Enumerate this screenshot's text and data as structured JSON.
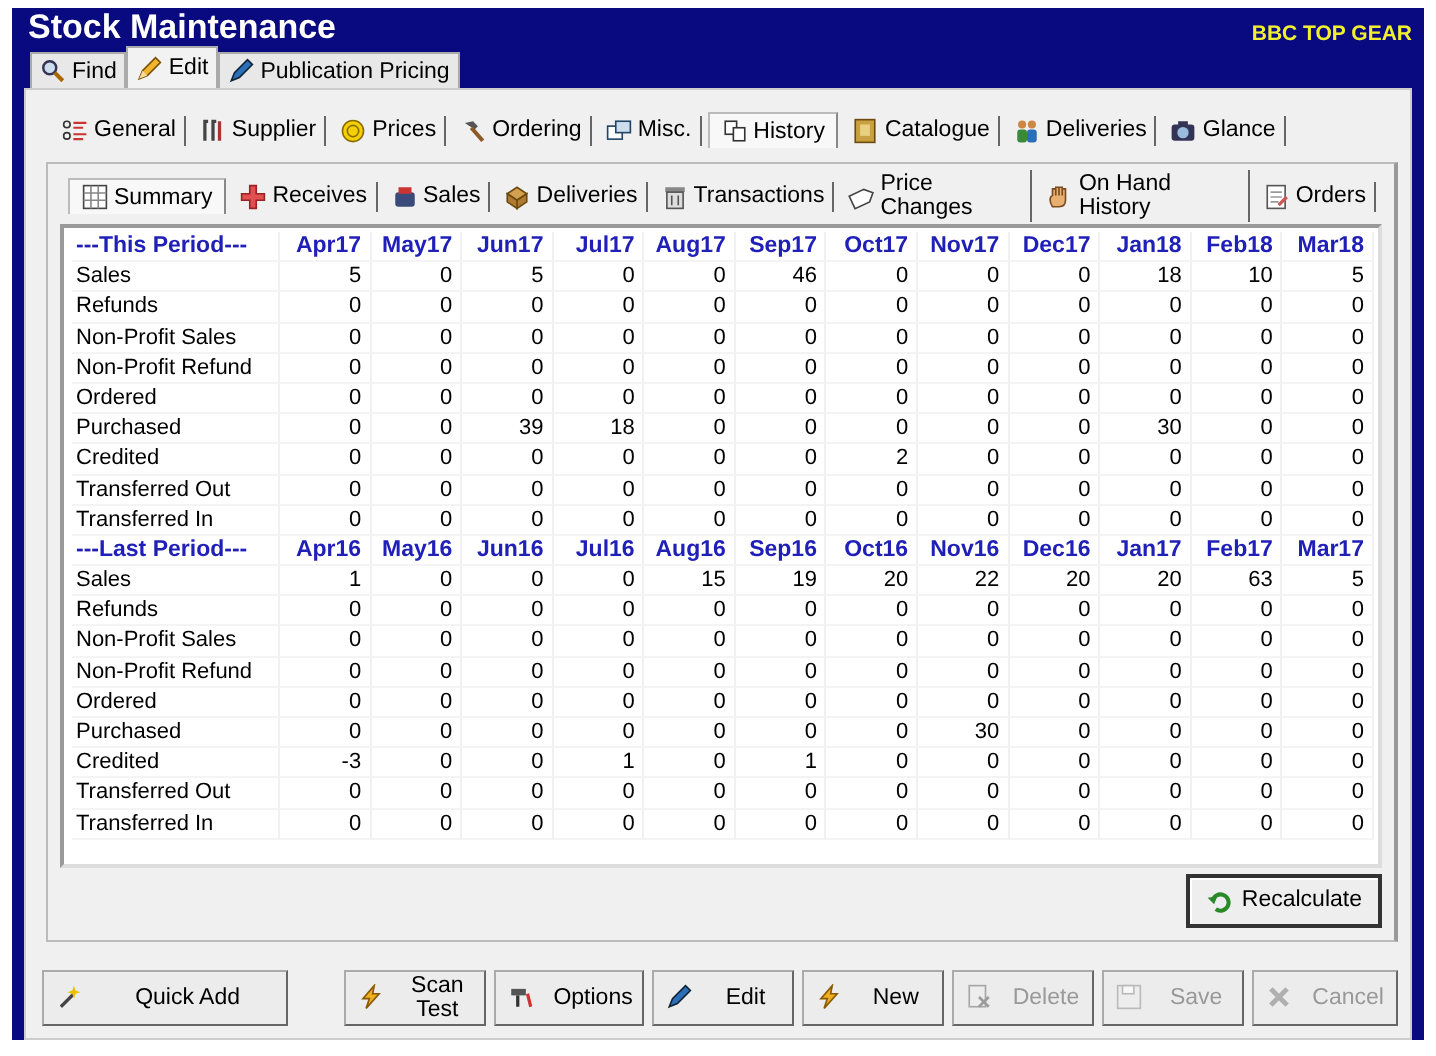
{
  "window": {
    "title": "Stock Maintenance",
    "store": "BBC TOP GEAR"
  },
  "tabs": [
    {
      "label": "Find",
      "selected": false
    },
    {
      "label": "Edit",
      "selected": true
    },
    {
      "label": "Publication Pricing",
      "selected": false
    }
  ],
  "section_tabs": [
    {
      "label": "General",
      "selected": false
    },
    {
      "label": "Supplier",
      "selected": false
    },
    {
      "label": "Prices",
      "selected": false
    },
    {
      "label": "Ordering",
      "selected": false
    },
    {
      "label": "Misc.",
      "selected": false
    },
    {
      "label": "History",
      "selected": true
    },
    {
      "label": "Catalogue",
      "selected": false
    },
    {
      "label": "Deliveries",
      "selected": false
    },
    {
      "label": "Glance",
      "selected": false
    }
  ],
  "history_tabs": [
    {
      "label": "Summary",
      "selected": true
    },
    {
      "label": "Receives",
      "selected": false
    },
    {
      "label": "Sales",
      "selected": false
    },
    {
      "label": "Deliveries",
      "selected": false
    },
    {
      "label": "Transactions",
      "selected": false
    },
    {
      "label": "Price Changes",
      "selected": false
    },
    {
      "label": "On Hand History",
      "selected": false
    },
    {
      "label": "Orders",
      "selected": false
    }
  ],
  "periods": [
    {
      "title": "---This Period---",
      "months": [
        "Apr17",
        "May17",
        "Jun17",
        "Jul17",
        "Aug17",
        "Sep17",
        "Oct17",
        "Nov17",
        "Dec17",
        "Jan18",
        "Feb18",
        "Mar18"
      ],
      "rows": [
        {
          "label": "Sales",
          "values": [
            "5",
            "0",
            "5",
            "0",
            "0",
            "46",
            "0",
            "0",
            "0",
            "18",
            "10",
            "5"
          ]
        },
        {
          "label": "Refunds",
          "values": [
            "0",
            "0",
            "0",
            "0",
            "0",
            "0",
            "0",
            "0",
            "0",
            "0",
            "0",
            "0"
          ]
        },
        {
          "label": "Non-Profit Sales",
          "values": [
            "0",
            "0",
            "0",
            "0",
            "0",
            "0",
            "0",
            "0",
            "0",
            "0",
            "0",
            "0"
          ]
        },
        {
          "label": "Non-Profit Refund",
          "values": [
            "0",
            "0",
            "0",
            "0",
            "0",
            "0",
            "0",
            "0",
            "0",
            "0",
            "0",
            "0"
          ]
        },
        {
          "label": "Ordered",
          "values": [
            "0",
            "0",
            "0",
            "0",
            "0",
            "0",
            "0",
            "0",
            "0",
            "0",
            "0",
            "0"
          ]
        },
        {
          "label": "Purchased",
          "values": [
            "0",
            "0",
            "39",
            "18",
            "0",
            "0",
            "0",
            "0",
            "0",
            "30",
            "0",
            "0"
          ]
        },
        {
          "label": "Credited",
          "values": [
            "0",
            "0",
            "0",
            "0",
            "0",
            "0",
            "2",
            "0",
            "0",
            "0",
            "0",
            "0"
          ]
        },
        {
          "label": "Transferred Out",
          "values": [
            "0",
            "0",
            "0",
            "0",
            "0",
            "0",
            "0",
            "0",
            "0",
            "0",
            "0",
            "0"
          ]
        },
        {
          "label": "Transferred In",
          "values": [
            "0",
            "0",
            "0",
            "0",
            "0",
            "0",
            "0",
            "0",
            "0",
            "0",
            "0",
            "0"
          ]
        }
      ]
    },
    {
      "title": "---Last Period---",
      "months": [
        "Apr16",
        "May16",
        "Jun16",
        "Jul16",
        "Aug16",
        "Sep16",
        "Oct16",
        "Nov16",
        "Dec16",
        "Jan17",
        "Feb17",
        "Mar17"
      ],
      "rows": [
        {
          "label": "Sales",
          "values": [
            "1",
            "0",
            "0",
            "0",
            "15",
            "19",
            "20",
            "22",
            "20",
            "20",
            "63",
            "5"
          ]
        },
        {
          "label": "Refunds",
          "values": [
            "0",
            "0",
            "0",
            "0",
            "0",
            "0",
            "0",
            "0",
            "0",
            "0",
            "0",
            "0"
          ]
        },
        {
          "label": "Non-Profit Sales",
          "values": [
            "0",
            "0",
            "0",
            "0",
            "0",
            "0",
            "0",
            "0",
            "0",
            "0",
            "0",
            "0"
          ]
        },
        {
          "label": "Non-Profit Refund",
          "values": [
            "0",
            "0",
            "0",
            "0",
            "0",
            "0",
            "0",
            "0",
            "0",
            "0",
            "0",
            "0"
          ]
        },
        {
          "label": "Ordered",
          "values": [
            "0",
            "0",
            "0",
            "0",
            "0",
            "0",
            "0",
            "0",
            "0",
            "0",
            "0",
            "0"
          ]
        },
        {
          "label": "Purchased",
          "values": [
            "0",
            "0",
            "0",
            "0",
            "0",
            "0",
            "0",
            "30",
            "0",
            "0",
            "0",
            "0"
          ]
        },
        {
          "label": "Credited",
          "values": [
            "-3",
            "0",
            "0",
            "1",
            "0",
            "1",
            "0",
            "0",
            "0",
            "0",
            "0",
            "0"
          ]
        },
        {
          "label": "Transferred Out",
          "values": [
            "0",
            "0",
            "0",
            "0",
            "0",
            "0",
            "0",
            "0",
            "0",
            "0",
            "0",
            "0"
          ]
        },
        {
          "label": "Transferred In",
          "values": [
            "0",
            "0",
            "0",
            "0",
            "0",
            "0",
            "0",
            "0",
            "0",
            "0",
            "0",
            "0"
          ]
        }
      ]
    }
  ],
  "recalculate": {
    "label": "Recalculate"
  },
  "buttons": [
    {
      "label": "Quick Add",
      "disabled": false
    },
    {
      "label": "Scan Test",
      "disabled": false
    },
    {
      "label": "Options",
      "disabled": false
    },
    {
      "label": "Edit",
      "disabled": false
    },
    {
      "label": "New",
      "disabled": false
    },
    {
      "label": "Delete",
      "disabled": true
    },
    {
      "label": "Save",
      "disabled": true
    },
    {
      "label": "Cancel",
      "disabled": true
    }
  ]
}
